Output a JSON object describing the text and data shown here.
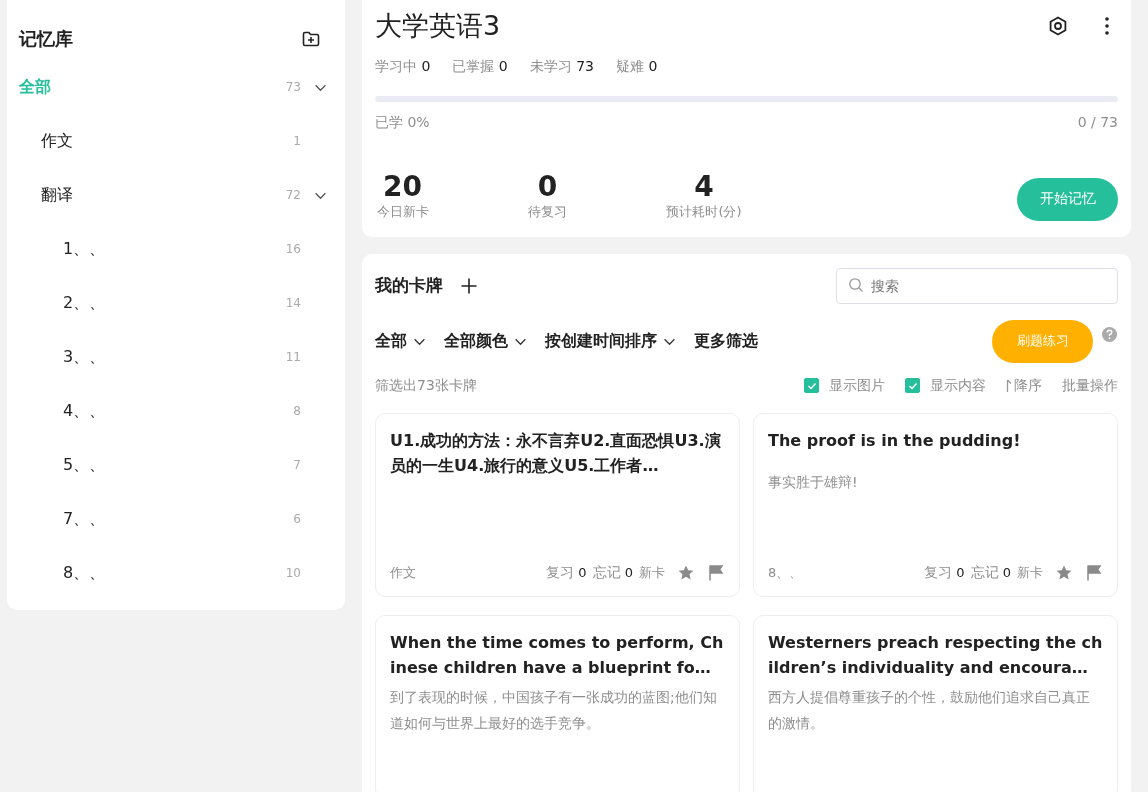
{
  "sidebar": {
    "title": "记忆库",
    "tree": [
      {
        "label": "全部",
        "count": "73",
        "selected": true,
        "expanded": true,
        "children": [
          {
            "label": "作文",
            "count": "1",
            "selected": false,
            "expanded": false
          },
          {
            "label": "翻译",
            "count": "72",
            "selected": false,
            "expanded": true,
            "children": [
              {
                "label": "1、、",
                "count": "16",
                "selected": false,
                "expanded": false
              },
              {
                "label": "2、、",
                "count": "14",
                "selected": false,
                "expanded": false
              },
              {
                "label": "3、、",
                "count": "11",
                "selected": false,
                "expanded": false
              },
              {
                "label": "4、、",
                "count": "8",
                "selected": false,
                "expanded": false
              },
              {
                "label": "5、、",
                "count": "7",
                "selected": false,
                "expanded": false
              },
              {
                "label": "7、、",
                "count": "6",
                "selected": false,
                "expanded": false
              },
              {
                "label": "8、、",
                "count": "10",
                "selected": false,
                "expanded": false
              }
            ]
          }
        ]
      }
    ]
  },
  "deck": {
    "title": "大学英语3",
    "stats": [
      {
        "label": "学习中",
        "value": "0"
      },
      {
        "label": "已掌握",
        "value": "0"
      },
      {
        "label": "未学习",
        "value": "73"
      },
      {
        "label": "疑难",
        "value": "0"
      }
    ],
    "progress": {
      "level": 0,
      "label": "已学 0%",
      "reading": "0 / 73"
    },
    "figures": [
      {
        "value": "20",
        "label": "今日新卡"
      },
      {
        "value": "0",
        "label": "待复习"
      },
      {
        "value": "4",
        "label": "预计耗时(分)"
      }
    ],
    "start_button": "开始记忆"
  },
  "cards_panel": {
    "title": "我的卡牌",
    "search": {
      "placeholder": "搜索"
    },
    "filters": [
      {
        "label": "全部",
        "dropdown": true
      },
      {
        "label": "全部颜色",
        "dropdown": true
      },
      {
        "label": "按创建时间排序",
        "dropdown": true
      },
      {
        "label": "更多筛选",
        "dropdown": false
      }
    ],
    "practice_button": "刷题练习",
    "count_text": "筛选出73张卡牌",
    "toggles": [
      {
        "label": "显示图片",
        "checked": true
      },
      {
        "label": "显示内容",
        "checked": true
      }
    ],
    "sort_label": "降序",
    "batch_label": "批量操作",
    "cards": [
      {
        "title": "U1.成功的方法：永不言弃U2.直面恐惧U3.演员的一生U4.旅行的意义U5.工作者…",
        "tag": "作文",
        "review_label": "复习",
        "review": "0",
        "forget_label": "忘记",
        "forget": "0",
        "status": "新卡"
      },
      {
        "title": "The proof is in the pudding!",
        "content": "事实胜于雄辩!",
        "tag": "8、、",
        "review_label": "复习",
        "review": "0",
        "forget_label": "忘记",
        "forget": "0",
        "status": "新卡"
      },
      {
        "title": "When the time comes to perform, Chinese children have a blueprint fo…",
        "content": "到了表现的时候，中国孩子有一张成功的蓝图;他们知道如何与世界上最好的选手竞争。"
      },
      {
        "title": "Westerners preach respecting the children’s individuality and encoura…",
        "content": "西方人提倡尊重孩子的个性，鼓励他们追求自己真正的激情。"
      }
    ]
  }
}
